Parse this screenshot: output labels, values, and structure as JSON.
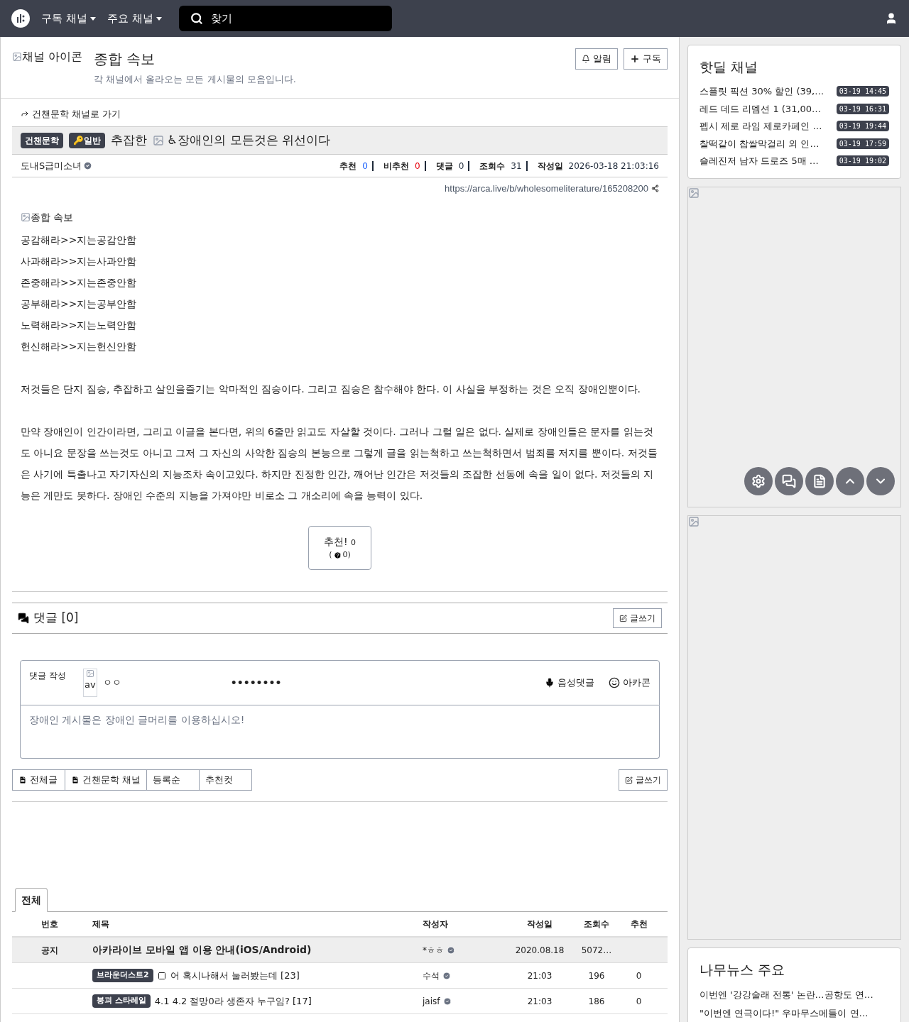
{
  "navbar": {
    "menus": [
      "구독 채널",
      "주요 채널"
    ],
    "search": {
      "placeholder": "찾기"
    }
  },
  "channel": {
    "icon_alt": "채널 아이콘",
    "title": "종합 속보",
    "description": "각 채널에서 올라오는 모든 게시물의 모음입니다.",
    "buttons": [
      "알림",
      "구독"
    ]
  },
  "post": {
    "back_link": "건챈문학 채널로 가기",
    "badges": [
      "건챈문학",
      "🔑일반"
    ],
    "title_prefix": "추잡한",
    "title_suffix": "♿장애인의 모든것은 위선이다",
    "author": "도내S급미소녀",
    "stats": [
      {
        "label": "추천",
        "value": "0",
        "kind": "up"
      },
      {
        "label": "비추천",
        "value": "0",
        "kind": "down"
      },
      {
        "label": "댓글",
        "value": "0",
        "kind": "plain"
      },
      {
        "label": "조회수",
        "value": "31",
        "kind": "plain"
      },
      {
        "label": "작성일",
        "value": "2026-03-18 21:03:16",
        "kind": "plain"
      }
    ],
    "url": "https://arca.live/b/wholesomeliterature/165208200",
    "image_alt": "종합 속보",
    "lines": [
      "공감해라>>지는공감안함",
      "사과해라>>지는사과안함",
      "존중해라>>지는존중안함",
      "공부해라>>지는공부안함",
      "노력해라>>지는노력안함",
      "헌신해라>>지는헌신안함"
    ],
    "paragraphs": [
      "저것들은 단지 짐승, 추잡하고 살인을즐기는 악마적인 짐승이다. 그리고 짐승은 참수해야 한다. 이 사실을 부정하는 것은 오직 장애인뿐이다.",
      "만약 장애인이 인간이라면, 그리고 이글을 본다면, 위의 6줄만 읽고도 자살할 것이다. 그러나 그럴 일은 없다. 실제로 장애인들은 문자를 읽는것도 아니요 문장을 쓰는것도 아니고 그저 그 자신의 사악한 짐승의 본능으로 그렇게 글을 읽는척하고 쓰는척하면서 범죄를 저지를 뿐이다. 저것들은 사기에 특출나고 자기자신의 지능조차 속이고있다. 하지만 진정한 인간, 깨어난 인간은 저것들의 조잡한 선동에 속을 일이 없다. 저것들의 지능은 게만도 못하다. 장애인 수준의 지능을 가져야만 비로소 그 개소리에 속을 능력이 있다."
    ],
    "vote": {
      "label": "추천!",
      "count": "0",
      "sub_open": "(",
      "sub": "0)"
    }
  },
  "comments": {
    "title": "댓글 [0]",
    "write_button": "글쓰기",
    "form": {
      "label": "댓글 작성",
      "avatar_alt": "av",
      "nickname": "ㅇㅇ",
      "password": "••••••••",
      "voice": "음성댓글",
      "arcacon": "아카콘",
      "placeholder": "장애인 게시물은 장애인 글머리를 이용하십시오!"
    }
  },
  "filters": [
    {
      "label": "전체글",
      "icon": true
    },
    {
      "label": "건챈문학 채널",
      "icon": true
    },
    {
      "label": "등록순",
      "icon": false
    },
    {
      "label": "추천컷",
      "icon": false
    }
  ],
  "filter_write": "글쓰기",
  "board": {
    "tabs": [
      {
        "label": "전체",
        "selected": true
      }
    ],
    "columns": [
      "번호",
      "제목",
      "작성자",
      "작성일",
      "조회수",
      "추천"
    ],
    "rows": [
      {
        "kind": "notice",
        "number": "공지",
        "title": "아카라이브 모바일 앱 이용 안내(iOS/Android)",
        "author": "*ㅎㅎ",
        "date": "2020.08.18",
        "views": "5072…",
        "likes": ""
      },
      {
        "kind": "post",
        "badge": "브라운더스트2",
        "has_image": true,
        "title": "어 혹시나해서 눌러봤는데",
        "comments": "[23]",
        "author": "수석",
        "date": "21:03",
        "views": "196",
        "likes": "0"
      },
      {
        "kind": "post",
        "badge": "붕괴 스타레일",
        "has_image": false,
        "title": "4.1 4.2 절망0라 생존자 누구임?",
        "comments": "[17]",
        "author": "jaisf",
        "date": "21:03",
        "views": "186",
        "likes": "0"
      }
    ]
  },
  "sidebar": {
    "hotdeal": {
      "title": "핫딜 채널",
      "items": [
        {
          "title": "스플릿 픽션 30% 할인 (39,…",
          "time": "03-19 14:45"
        },
        {
          "title": "레드 데드 리뎀션 1 (31,00…",
          "time": "03-19 16:31"
        },
        {
          "title": "펩시 제로 라임 제로카페인 …",
          "time": "03-19 19:44"
        },
        {
          "title": "찰떡같이 찹쌀막걸리 외 인…",
          "time": "03-19 17:59"
        },
        {
          "title": "슬레진저 남자 드로즈 5매 …",
          "time": "03-19 19:02"
        }
      ]
    },
    "news": {
      "title": "나무뉴스 주요",
      "items": [
        "이번엔 '강강술래 전통' 논란…공항도 연…",
        "\"이번엔 연극이다!\" 우마무스메들이 연…"
      ]
    }
  }
}
